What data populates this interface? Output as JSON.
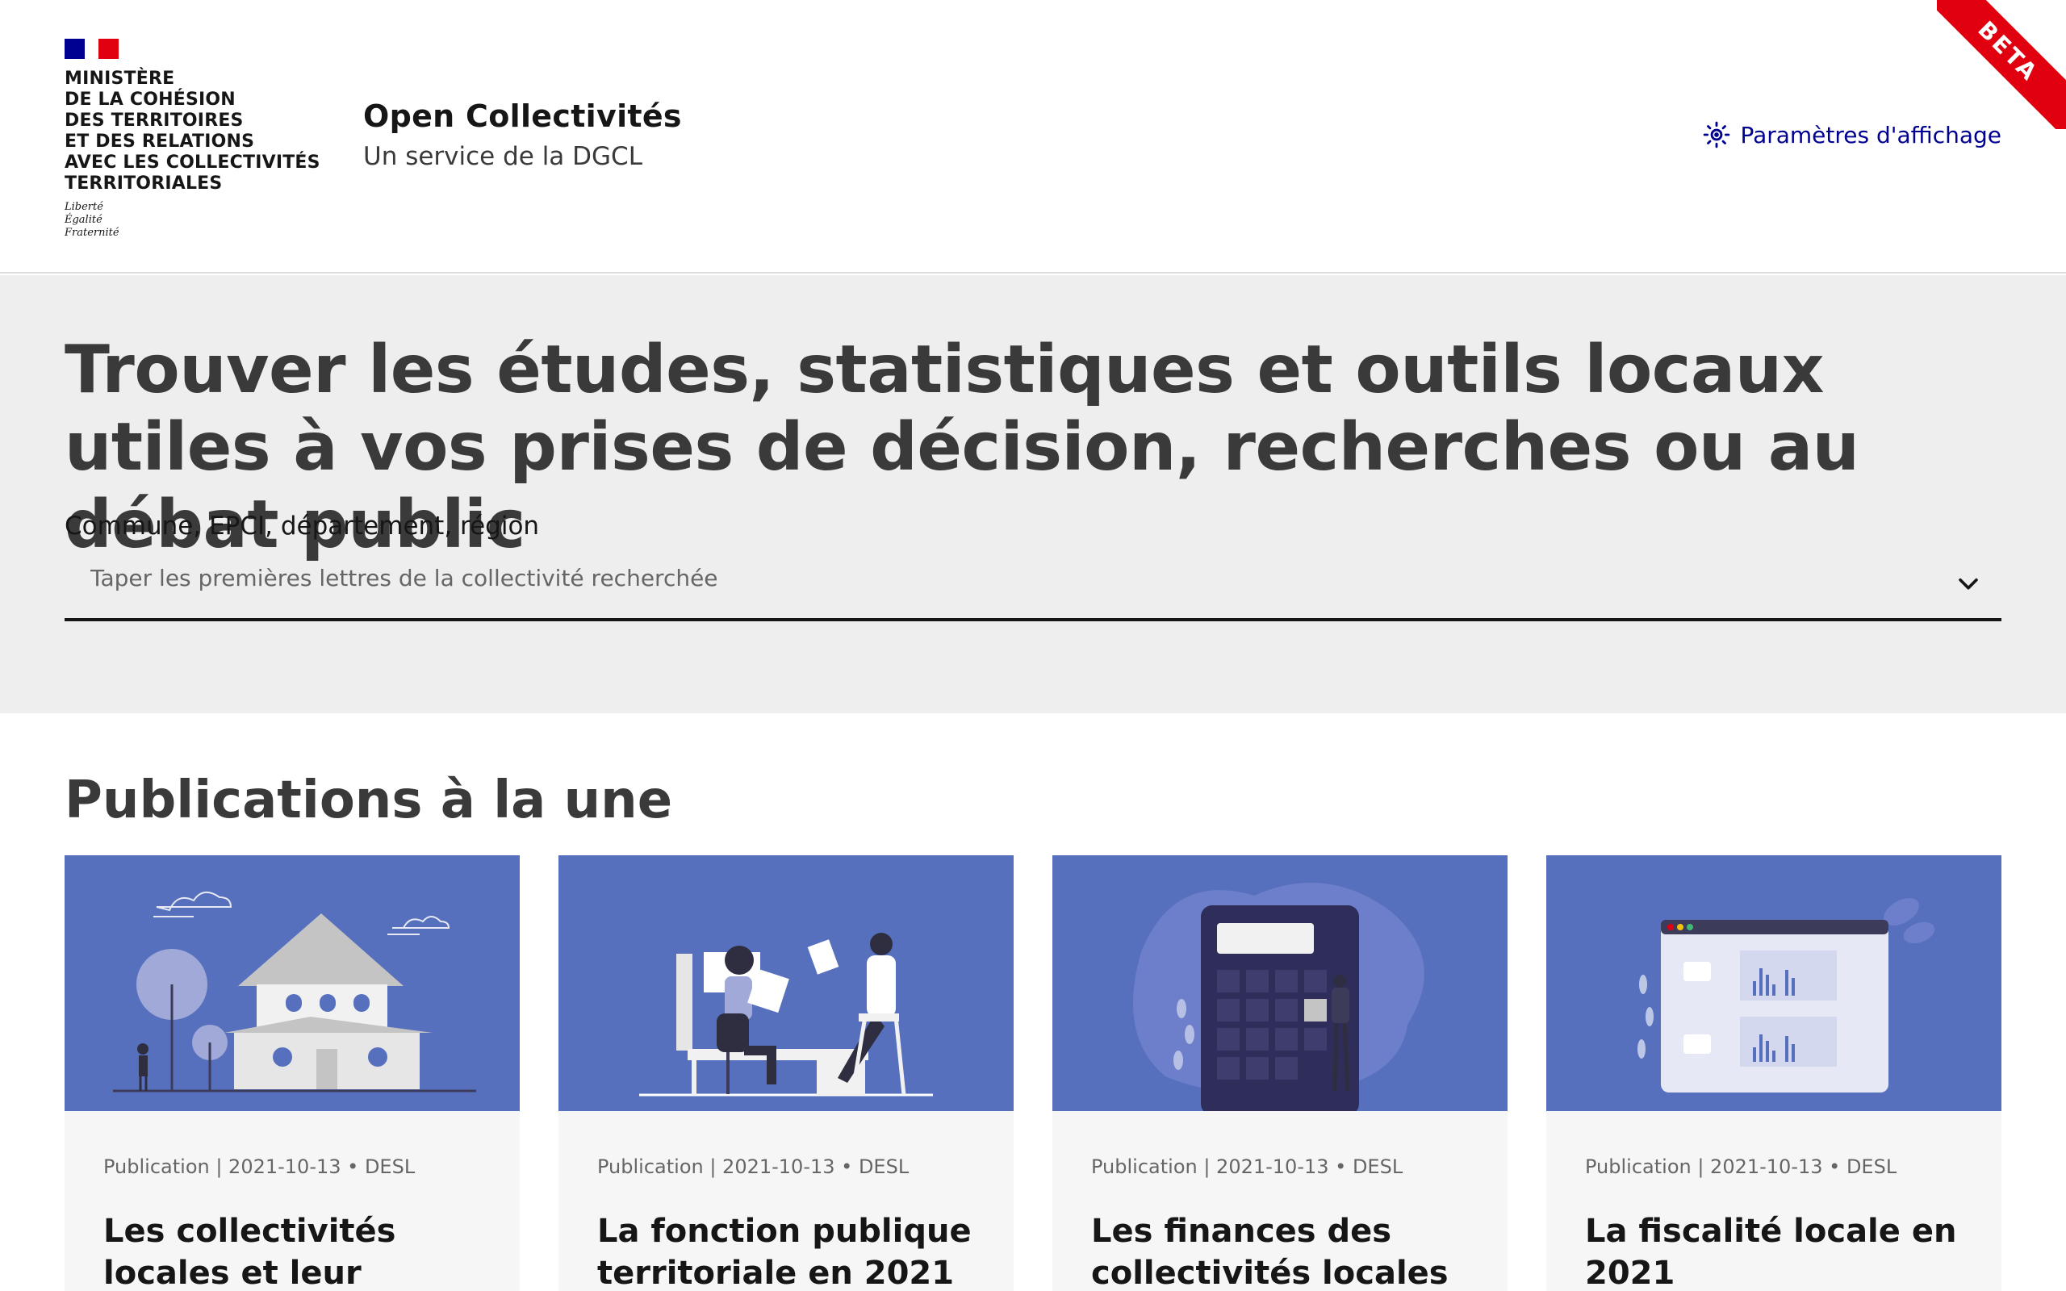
{
  "header": {
    "ministry_lines": [
      "MINISTÈRE",
      "DE LA COHÉSION",
      "DES TERRITOIRES",
      "ET DES RELATIONS",
      "AVEC LES COLLECTIVITÉS",
      "TERRITORIALES"
    ],
    "motto_lines": [
      "Liberté",
      "Égalité",
      "Fraternité"
    ],
    "service_title": "Open Collectivités",
    "service_tagline": "Un service de la DGCL",
    "display_settings_label": "Paramètres d'affichage",
    "display_settings_icon": "sun-icon",
    "beta_label": "BETA"
  },
  "hero": {
    "title": "Trouver les études, statistiques et outils locaux utiles à vos prises de décision, recherches ou au débat public",
    "search_label": "Commune, EPCI, département, région",
    "search_placeholder": "Taper les premières lettres de la collectivité recherchée",
    "search_value": ""
  },
  "publications": {
    "heading": "Publications à la une",
    "cards": [
      {
        "meta": "Publication | 2021-10-13 • DESL",
        "title": "Les collectivités locales et leur population en",
        "illustration": "house-illustration"
      },
      {
        "meta": "Publication | 2021-10-13 • DESL",
        "title": "La fonction publique territoriale en 2021",
        "illustration": "office-workers-illustration"
      },
      {
        "meta": "Publication | 2021-10-13 • DESL",
        "title": "Les finances des collectivités locales en",
        "illustration": "calculator-illustration"
      },
      {
        "meta": "Publication | 2021-10-13 • DESL",
        "title": "La fiscalité locale en 2021",
        "illustration": "dashboard-illustration"
      }
    ]
  },
  "colors": {
    "brand_blue": "#000091",
    "brand_red": "#e1000f",
    "card_image_bg": "#5770be",
    "hero_bg": "#eeeeee"
  }
}
